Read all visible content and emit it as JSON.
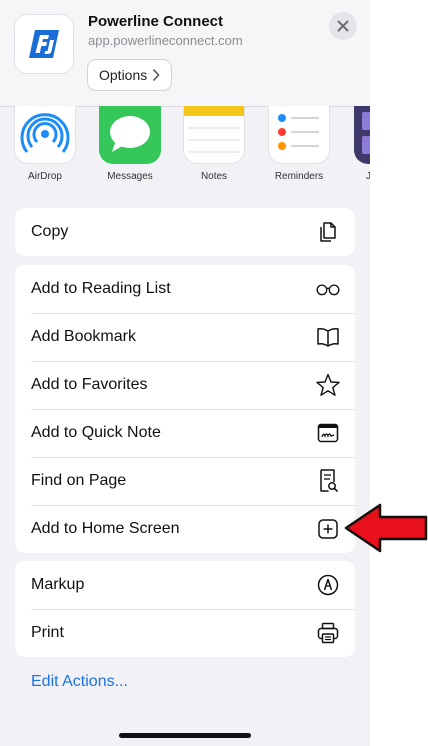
{
  "header": {
    "app_name": "Powerline Connect",
    "app_url": "app.powerlineconnect.com",
    "options_label": "Options",
    "brand_color": "#1a6dd6"
  },
  "share_targets": [
    {
      "label": "AirDrop",
      "icon": "airdrop-icon"
    },
    {
      "label": "Messages",
      "icon": "messages-icon"
    },
    {
      "label": "Notes",
      "icon": "notes-icon"
    },
    {
      "label": "Reminders",
      "icon": "reminders-icon"
    },
    {
      "label": "J",
      "icon": "partial-app-icon"
    }
  ],
  "actions_group1": [
    {
      "label": "Copy",
      "icon": "copy-icon"
    }
  ],
  "actions_group2": [
    {
      "label": "Add to Reading List",
      "icon": "glasses-icon"
    },
    {
      "label": "Add Bookmark",
      "icon": "book-icon"
    },
    {
      "label": "Add to Favorites",
      "icon": "star-icon"
    },
    {
      "label": "Add to Quick Note",
      "icon": "quick-note-icon"
    },
    {
      "label": "Find on Page",
      "icon": "find-on-page-icon"
    },
    {
      "label": "Add to Home Screen",
      "icon": "add-square-icon"
    }
  ],
  "actions_group3": [
    {
      "label": "Markup",
      "icon": "markup-icon"
    },
    {
      "label": "Print",
      "icon": "printer-icon"
    }
  ],
  "edit_actions_label": "Edit Actions...",
  "colors": {
    "link_blue": "#1a73e8",
    "annotation_arrow": "#e8101a"
  }
}
